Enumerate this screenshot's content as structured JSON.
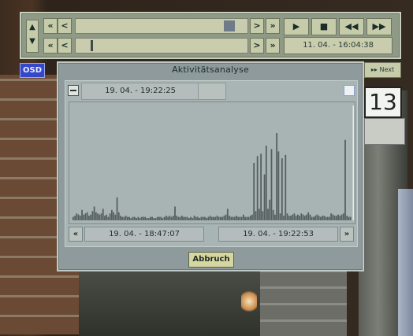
{
  "panel": {
    "updown_up": "▲",
    "updown_down": "▼",
    "row1": {
      "first": "«",
      "prev": "<",
      "next": ">",
      "last": "»",
      "position": 0.93
    },
    "row2": {
      "first": "«",
      "prev": "<",
      "next": ">",
      "last": "»",
      "position": 0.09
    },
    "play": "▶",
    "stop": "■",
    "rewind": "◀◀",
    "fastforward": "▶▶",
    "datetime": "11. 04. - 16:04:38"
  },
  "osd_label": "OSD",
  "next_label": "▸▸ Next",
  "dialog": {
    "title": "Aktivitätsanalyse",
    "cursor_time": "19. 04. - 19:22:25",
    "range_start": "19. 04. - 18:47:07",
    "range_end": "19. 04. - 19:22:53",
    "scroll_left": "«",
    "scroll_right": "»",
    "cancel_label": "Abbruch"
  },
  "scene": {
    "sign_number": "13"
  },
  "chart_data": {
    "type": "bar",
    "xlabel": "",
    "ylabel": "",
    "ylim": [
      0,
      100
    ],
    "x_range": [
      "19. 04. - 18:47:07",
      "19. 04. - 19:22:53"
    ],
    "values": [
      3,
      4,
      6,
      5,
      4,
      9,
      5,
      6,
      7,
      4,
      5,
      8,
      12,
      7,
      6,
      5,
      6,
      10,
      4,
      5,
      3,
      6,
      9,
      7,
      5,
      20,
      7,
      4,
      3,
      3,
      4,
      3,
      3,
      2,
      3,
      3,
      2,
      3,
      2,
      3,
      3,
      3,
      2,
      2,
      3,
      3,
      2,
      2,
      3,
      3,
      3,
      2,
      3,
      4,
      3,
      4,
      3,
      4,
      12,
      4,
      3,
      3,
      4,
      3,
      3,
      3,
      2,
      3,
      2,
      4,
      3,
      3,
      2,
      3,
      3,
      3,
      2,
      3,
      4,
      3,
      3,
      3,
      4,
      3,
      3,
      3,
      4,
      5,
      10,
      4,
      3,
      3,
      3,
      4,
      3,
      3,
      3,
      5,
      3,
      3,
      3,
      4,
      5,
      50,
      8,
      56,
      10,
      58,
      8,
      40,
      65,
      10,
      18,
      62,
      9,
      5,
      76,
      60,
      6,
      54,
      4,
      57,
      6,
      4,
      4,
      5,
      6,
      4,
      5,
      4,
      6,
      5,
      4,
      5,
      7,
      5,
      3,
      3,
      4,
      5,
      4,
      3,
      4,
      4,
      3,
      3,
      3,
      6,
      5,
      4,
      4,
      5,
      4,
      5,
      6,
      70,
      4,
      3,
      3
    ],
    "cursor_index": 160,
    "colors": {
      "bars": "#555f5f",
      "background": "#a8b3b3",
      "cursor": "#e6ece9"
    }
  }
}
